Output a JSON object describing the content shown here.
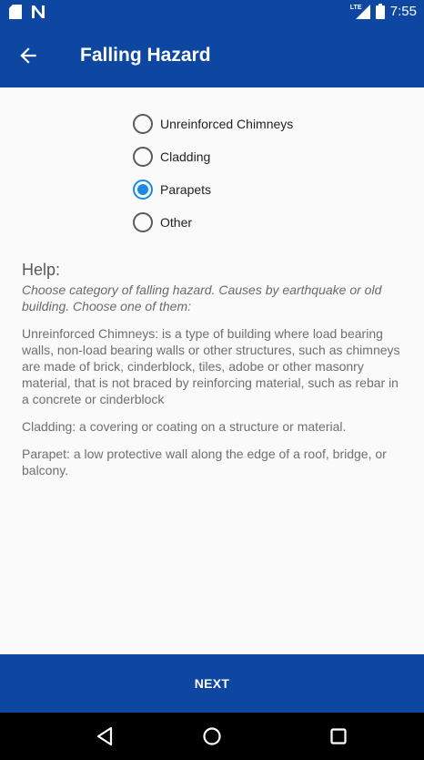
{
  "status_bar": {
    "time": "7:55",
    "network_label": "LTE",
    "icons": [
      "sd-card-icon",
      "n-notification-icon",
      "signal-icon",
      "battery-icon"
    ]
  },
  "app_bar": {
    "title": "Falling Hazard",
    "back_icon": "arrow-back-icon"
  },
  "options": [
    {
      "label": "Unreinforced Chimneys",
      "checked": false
    },
    {
      "label": "Cladding",
      "checked": false
    },
    {
      "label": "Parapets",
      "checked": true
    },
    {
      "label": "Other",
      "checked": false
    }
  ],
  "help": {
    "title": "Help:",
    "intro": "Choose category of falling hazard. Causes by earthquake or old building. Choose one of them:",
    "paragraphs": [
      "Unreinforced Chimneys: is a type of building where load bearing walls, non-load bearing walls or other structures, such as chimneys are made of brick, cinderblock, tiles, adobe or other masonry material, that is not braced by reinforcing material, such as rebar in a concrete or cinderblock",
      "Cladding: a covering or coating on a structure or material.",
      "Parapet: a low protective wall along the edge of a roof, bridge, or balcony."
    ]
  },
  "next_button": {
    "label": "NEXT"
  },
  "nav_bar": {
    "icons": [
      "back-triangle-icon",
      "home-circle-icon",
      "recents-square-icon"
    ]
  },
  "colors": {
    "primary": "#0d47a1",
    "accent": "#1e88e5",
    "background": "#fafafa"
  }
}
